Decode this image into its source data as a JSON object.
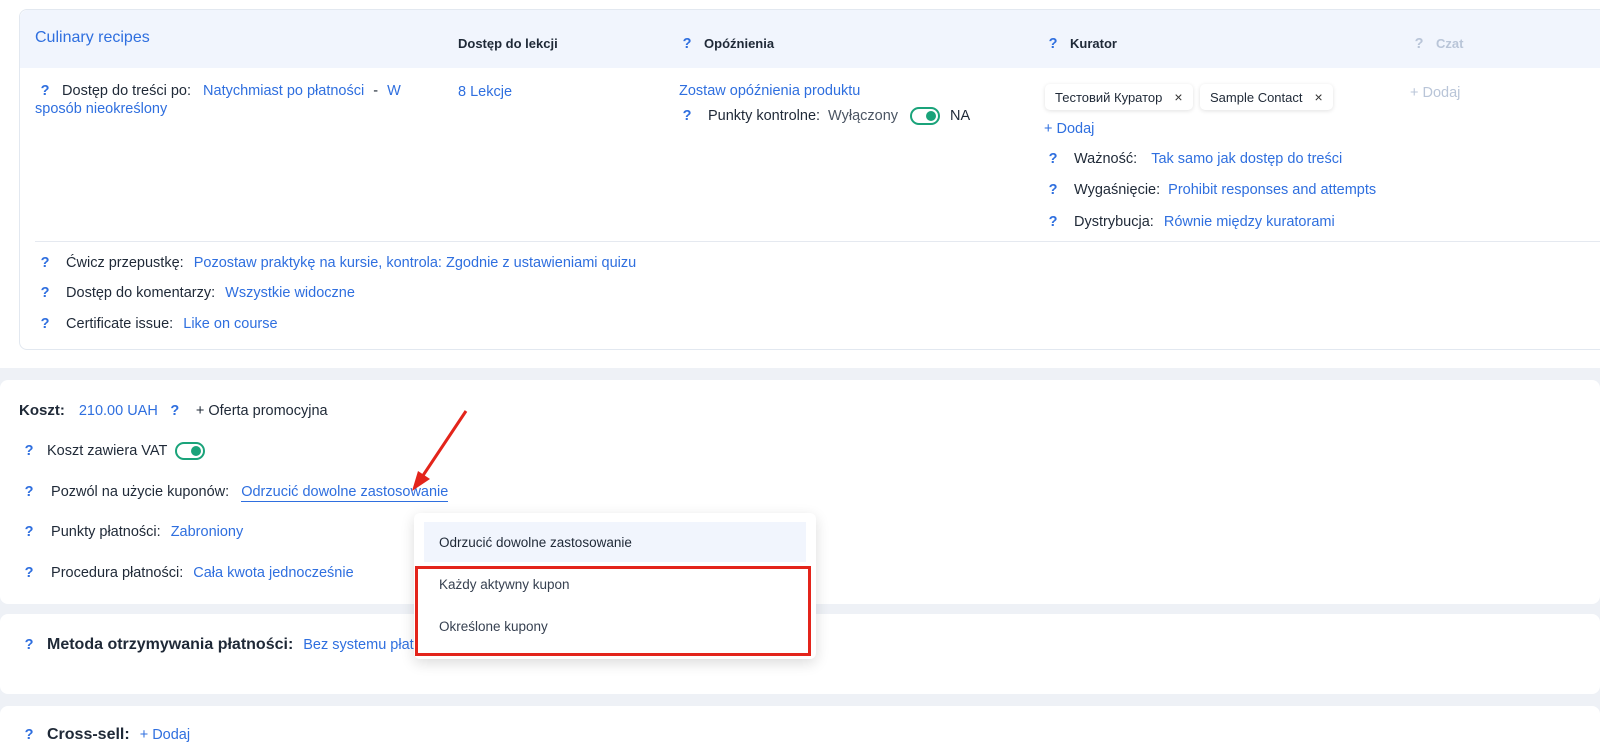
{
  "product": {
    "title": "Culinary recipes",
    "headers": {
      "access": "Dostęp do lekcji",
      "delays": "Opóźnienia",
      "curator": "Kurator",
      "chat": "Czat"
    },
    "access_after_label": "Dostęp do treści po:",
    "access_after_value": "Natychmiast po płatności",
    "access_separator": "-",
    "access_duration_line1": "W",
    "access_duration_line2": "sposób nieokreślony",
    "lessons": "8 Lekcje",
    "delays_link": "Zostaw opóźnienia produktu",
    "checkpoints_label": "Punkty kontrolne:",
    "checkpoints_off": "Wyłączony",
    "checkpoints_na": "NA",
    "curators": [
      {
        "name": "Тестовий Куратор"
      },
      {
        "name": "Sample Contact"
      }
    ],
    "curator_add": "+ Dodaj",
    "chat_add": "+ Dodaj",
    "validity_label": "Ważność:",
    "validity_value": "Tak samo jak dostęp do treści",
    "expiry_label": "Wygaśnięcie:",
    "expiry_value": "Prohibit responses and attempts",
    "distribution_label": "Dystrybucja:",
    "distribution_value": "Równie między kuratorami",
    "practice_label": "Ćwicz przepustkę:",
    "practice_value": "Pozostaw praktykę na kursie, kontrola: Zgodnie z ustawieniami quizu",
    "comments_label": "Dostęp do komentarzy:",
    "comments_value": "Wszystkie widoczne",
    "certificate_label": "Certificate issue:",
    "certificate_value": "Like on course",
    "close_glyph": "×",
    "help_glyph": "?"
  },
  "price": {
    "cost_label": "Koszt:",
    "cost_value": "210.00 UAH",
    "promo": "+ Oferta promocyjna",
    "vat_label": "Koszt zawiera VAT",
    "coupons_label": "Pozwól na użycie kuponów:",
    "coupons_value": "Odrzucić dowolne zastosowanie",
    "points_label": "Punkty płatności:",
    "points_value": "Zabroniony",
    "procedure_label": "Procedura płatności:",
    "procedure_value": "Cała kwota jednocześnie"
  },
  "method": {
    "label": "Metoda otrzymywania płatności:",
    "value": "Bez systemu płatn"
  },
  "cross": {
    "label": "Cross-sell:",
    "add": "+ Dodaj"
  },
  "dropdown": {
    "options": [
      "Odrzucić dowolne zastosowanie",
      "Każdy aktywny kupon",
      "Określone kupony"
    ],
    "selected_index": 0
  },
  "colors": {
    "accent": "#2f6fdf",
    "toggle_on": "#1aa37a",
    "annotation": "#e3241b"
  }
}
